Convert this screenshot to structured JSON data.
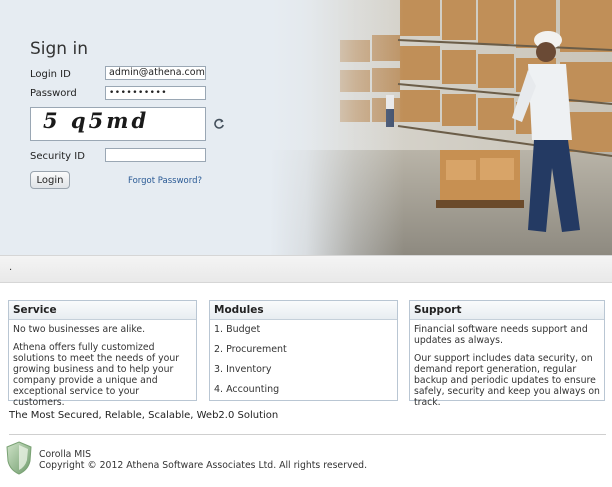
{
  "signin": {
    "title": "Sign in",
    "login_id_label": "Login ID",
    "login_id_value": "admin@athena.com",
    "password_label": "Password",
    "password_value": "••••••••••",
    "captcha_text": "5 q5md",
    "security_id_label": "Security ID",
    "security_id_value": "",
    "login_button": "Login",
    "forgot_link": "Forgot Password?"
  },
  "strip": {
    "text": "."
  },
  "panels": {
    "service": {
      "title": "Service",
      "p1": "No two businesses are alike.",
      "p2": "Athena offers fully customized solutions to meet the needs of your growing business and to help your company provide a unique and exceptional service to your customers."
    },
    "modules": {
      "title": "Modules",
      "items": [
        "1. Budget",
        "2. Procurement",
        "3. Inventory",
        "4. Accounting"
      ]
    },
    "support": {
      "title": "Support",
      "p1": "Financial software needs support and updates as always.",
      "p2": "Our support includes data security, on demand report generation, regular backup and periodic updates to ensure safely, security and keep you always on track."
    }
  },
  "tagline": "The Most Secured, Relable, Scalable, Web2.0 Solution",
  "footer": {
    "product": "Corolla MIS",
    "copyright": "Copyright © 2012 Athena Software Associates Ltd. All rights reserved."
  },
  "icons": {
    "refresh": "refresh-icon",
    "logo": "shield-logo-icon",
    "photo": "warehouse-worker-image"
  }
}
